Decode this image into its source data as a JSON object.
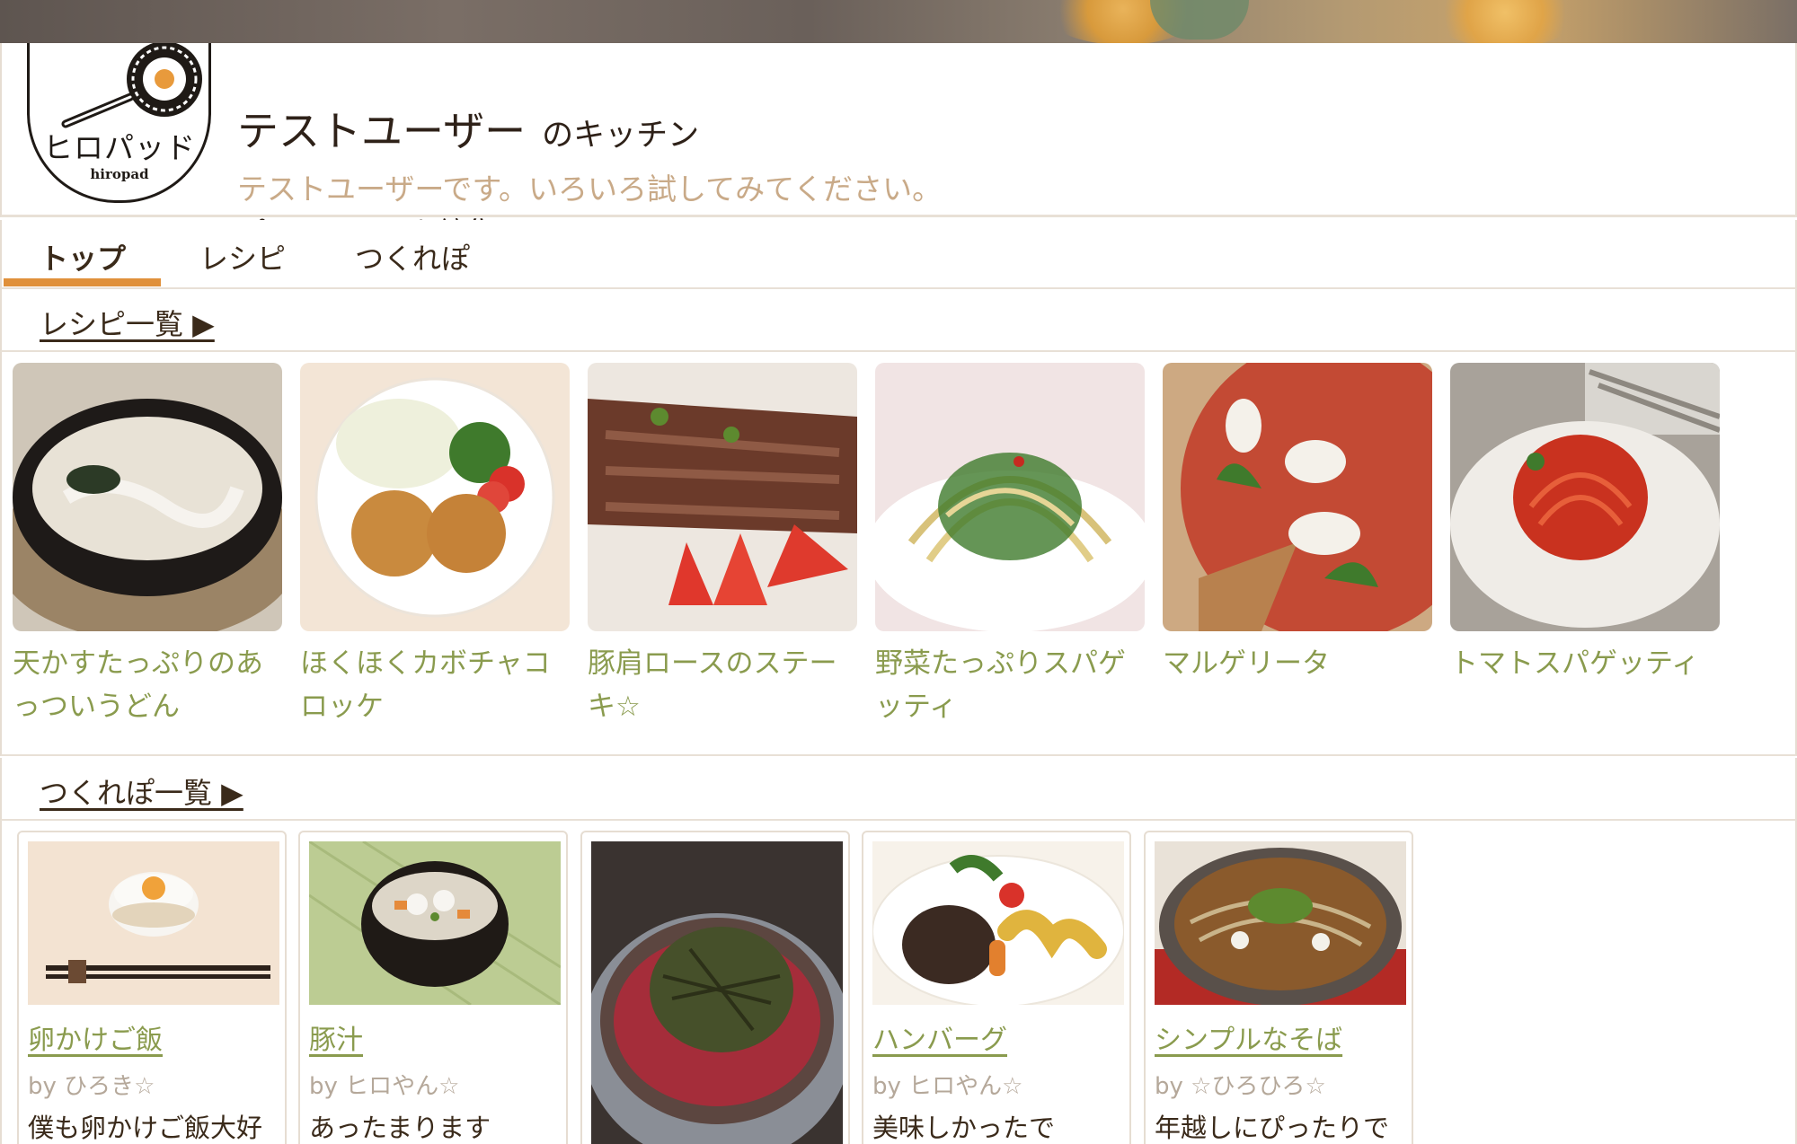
{
  "logo": {
    "text": "ヒロパッド",
    "sub": "hiropad"
  },
  "kitchen": {
    "user_name": "テストユーザー",
    "suffix": "のキッチン",
    "description": "テストユーザーです。いろいろ試してみてください。",
    "edit_profile": "プロフィールを編集"
  },
  "tabs": [
    {
      "label": "トップ",
      "active": true
    },
    {
      "label": "レシピ",
      "active": false
    },
    {
      "label": "つくれぽ",
      "active": false
    }
  ],
  "recipe_section": {
    "label": "レシピ一覧 ▶"
  },
  "recipes": [
    {
      "title": "天かすたっぷりのあっついうどん"
    },
    {
      "title": "ほくほくカボチャコロッケ"
    },
    {
      "title": "豚肩ロースのステーキ☆"
    },
    {
      "title": "野菜たっぷりスパゲッティ"
    },
    {
      "title": "マルゲリータ"
    },
    {
      "title": "トマトスパゲッティ"
    }
  ],
  "report_section": {
    "label": "つくれぽ一覧 ▶"
  },
  "reports": [
    {
      "title": "卵かけご飯",
      "by": "by ひろき☆",
      "message": "僕も卵かけご飯大好"
    },
    {
      "title": "豚汁",
      "by": "by ヒロやん☆",
      "message": "あったまります"
    },
    {
      "title": "",
      "by": "",
      "message": ""
    },
    {
      "title": "ハンバーグ",
      "by": "by ヒロやん☆",
      "message": "美味しかったで"
    },
    {
      "title": "シンプルなそば",
      "by": "by ☆ひろひろ☆",
      "message": "年越しにぴったりで"
    }
  ],
  "colors": {
    "accent": "#e0903a",
    "recipe_title": "#8a9b4e",
    "description": "#c9aa88",
    "text": "#3a2a1a"
  }
}
